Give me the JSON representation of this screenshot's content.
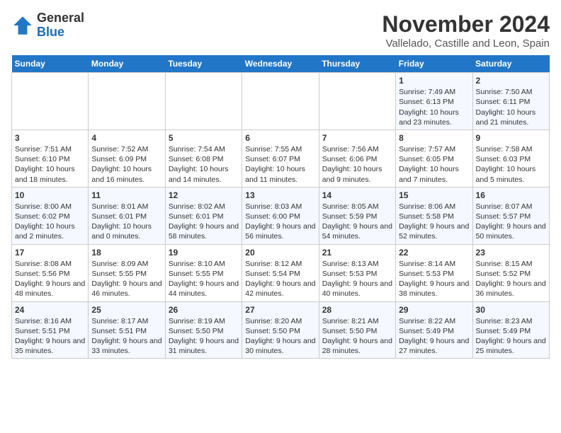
{
  "logo": {
    "general": "General",
    "blue": "Blue"
  },
  "title": "November 2024",
  "subtitle": "Vallelado, Castille and Leon, Spain",
  "days_of_week": [
    "Sunday",
    "Monday",
    "Tuesday",
    "Wednesday",
    "Thursday",
    "Friday",
    "Saturday"
  ],
  "weeks": [
    [
      {
        "day": "",
        "info": ""
      },
      {
        "day": "",
        "info": ""
      },
      {
        "day": "",
        "info": ""
      },
      {
        "day": "",
        "info": ""
      },
      {
        "day": "",
        "info": ""
      },
      {
        "day": "1",
        "info": "Sunrise: 7:49 AM\nSunset: 6:13 PM\nDaylight: 10 hours and 23 minutes."
      },
      {
        "day": "2",
        "info": "Sunrise: 7:50 AM\nSunset: 6:11 PM\nDaylight: 10 hours and 21 minutes."
      }
    ],
    [
      {
        "day": "3",
        "info": "Sunrise: 7:51 AM\nSunset: 6:10 PM\nDaylight: 10 hours and 18 minutes."
      },
      {
        "day": "4",
        "info": "Sunrise: 7:52 AM\nSunset: 6:09 PM\nDaylight: 10 hours and 16 minutes."
      },
      {
        "day": "5",
        "info": "Sunrise: 7:54 AM\nSunset: 6:08 PM\nDaylight: 10 hours and 14 minutes."
      },
      {
        "day": "6",
        "info": "Sunrise: 7:55 AM\nSunset: 6:07 PM\nDaylight: 10 hours and 11 minutes."
      },
      {
        "day": "7",
        "info": "Sunrise: 7:56 AM\nSunset: 6:06 PM\nDaylight: 10 hours and 9 minutes."
      },
      {
        "day": "8",
        "info": "Sunrise: 7:57 AM\nSunset: 6:05 PM\nDaylight: 10 hours and 7 minutes."
      },
      {
        "day": "9",
        "info": "Sunrise: 7:58 AM\nSunset: 6:03 PM\nDaylight: 10 hours and 5 minutes."
      }
    ],
    [
      {
        "day": "10",
        "info": "Sunrise: 8:00 AM\nSunset: 6:02 PM\nDaylight: 10 hours and 2 minutes."
      },
      {
        "day": "11",
        "info": "Sunrise: 8:01 AM\nSunset: 6:01 PM\nDaylight: 10 hours and 0 minutes."
      },
      {
        "day": "12",
        "info": "Sunrise: 8:02 AM\nSunset: 6:01 PM\nDaylight: 9 hours and 58 minutes."
      },
      {
        "day": "13",
        "info": "Sunrise: 8:03 AM\nSunset: 6:00 PM\nDaylight: 9 hours and 56 minutes."
      },
      {
        "day": "14",
        "info": "Sunrise: 8:05 AM\nSunset: 5:59 PM\nDaylight: 9 hours and 54 minutes."
      },
      {
        "day": "15",
        "info": "Sunrise: 8:06 AM\nSunset: 5:58 PM\nDaylight: 9 hours and 52 minutes."
      },
      {
        "day": "16",
        "info": "Sunrise: 8:07 AM\nSunset: 5:57 PM\nDaylight: 9 hours and 50 minutes."
      }
    ],
    [
      {
        "day": "17",
        "info": "Sunrise: 8:08 AM\nSunset: 5:56 PM\nDaylight: 9 hours and 48 minutes."
      },
      {
        "day": "18",
        "info": "Sunrise: 8:09 AM\nSunset: 5:55 PM\nDaylight: 9 hours and 46 minutes."
      },
      {
        "day": "19",
        "info": "Sunrise: 8:10 AM\nSunset: 5:55 PM\nDaylight: 9 hours and 44 minutes."
      },
      {
        "day": "20",
        "info": "Sunrise: 8:12 AM\nSunset: 5:54 PM\nDaylight: 9 hours and 42 minutes."
      },
      {
        "day": "21",
        "info": "Sunrise: 8:13 AM\nSunset: 5:53 PM\nDaylight: 9 hours and 40 minutes."
      },
      {
        "day": "22",
        "info": "Sunrise: 8:14 AM\nSunset: 5:53 PM\nDaylight: 9 hours and 38 minutes."
      },
      {
        "day": "23",
        "info": "Sunrise: 8:15 AM\nSunset: 5:52 PM\nDaylight: 9 hours and 36 minutes."
      }
    ],
    [
      {
        "day": "24",
        "info": "Sunrise: 8:16 AM\nSunset: 5:51 PM\nDaylight: 9 hours and 35 minutes."
      },
      {
        "day": "25",
        "info": "Sunrise: 8:17 AM\nSunset: 5:51 PM\nDaylight: 9 hours and 33 minutes."
      },
      {
        "day": "26",
        "info": "Sunrise: 8:19 AM\nSunset: 5:50 PM\nDaylight: 9 hours and 31 minutes."
      },
      {
        "day": "27",
        "info": "Sunrise: 8:20 AM\nSunset: 5:50 PM\nDaylight: 9 hours and 30 minutes."
      },
      {
        "day": "28",
        "info": "Sunrise: 8:21 AM\nSunset: 5:50 PM\nDaylight: 9 hours and 28 minutes."
      },
      {
        "day": "29",
        "info": "Sunrise: 8:22 AM\nSunset: 5:49 PM\nDaylight: 9 hours and 27 minutes."
      },
      {
        "day": "30",
        "info": "Sunrise: 8:23 AM\nSunset: 5:49 PM\nDaylight: 9 hours and 25 minutes."
      }
    ]
  ]
}
